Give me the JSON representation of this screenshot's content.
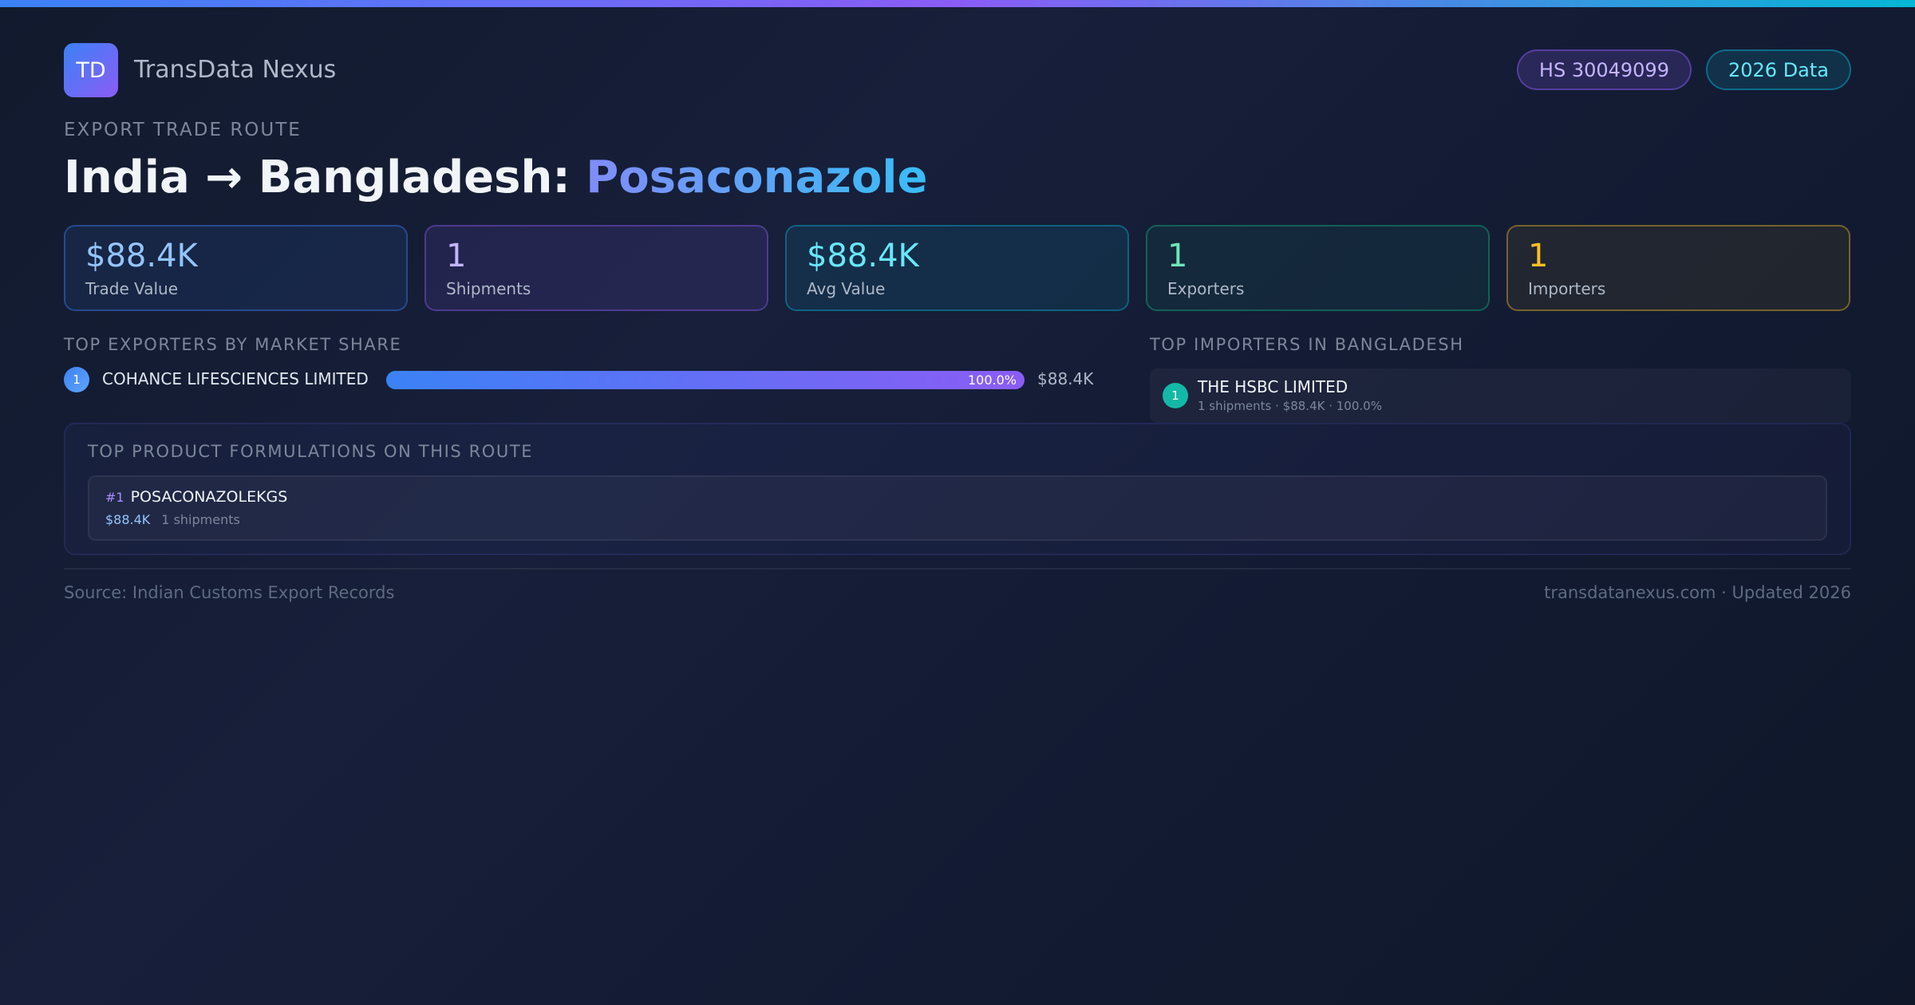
{
  "brand": {
    "logo_text": "TD",
    "name": "TransData Nexus"
  },
  "badges": {
    "hs_code": "HS 30049099",
    "year": "2026 Data"
  },
  "eyebrow": "EXPORT TRADE ROUTE",
  "title": {
    "route": "India → Bangladesh: ",
    "product": "Posaconazole"
  },
  "stats": [
    {
      "value": "$88.4K",
      "label": "Trade Value",
      "accent": "#93c5fd"
    },
    {
      "value": "1",
      "label": "Shipments",
      "accent": "#c4b5fd"
    },
    {
      "value": "$88.4K",
      "label": "Avg Value",
      "accent": "#67e8f9"
    },
    {
      "value": "1",
      "label": "Exporters",
      "accent": "#6ee7b7"
    },
    {
      "value": "1",
      "label": "Importers",
      "accent": "#fbbf24"
    }
  ],
  "exporters": {
    "title": "TOP EXPORTERS BY MARKET SHARE",
    "items": [
      {
        "rank": "1",
        "name": "COHANCE LIFESCIENCES LIMITED",
        "share_pct": 100.0,
        "share_label": "100.0%",
        "value": "$88.4K"
      }
    ]
  },
  "importers": {
    "title": "TOP IMPORTERS IN BANGLADESH",
    "items": [
      {
        "rank": "1",
        "name": "THE HSBC LIMITED",
        "meta": "1 shipments · $88.4K · 100.0%"
      }
    ]
  },
  "formulations": {
    "title": "TOP PRODUCT FORMULATIONS ON THIS ROUTE",
    "items": [
      {
        "rank": "#1",
        "name": "POSACONAZOLEKGS",
        "value": "$88.4K",
        "shipments": "1 shipments"
      }
    ]
  },
  "footer": {
    "source": "Source: Indian Customs Export Records",
    "site": "transdatanexus.com · Updated 2026"
  },
  "colors": {
    "blue": "#3b82f6",
    "purple": "#8b5cf6",
    "cyan": "#06b6d4",
    "teal": "#14b8a6"
  }
}
